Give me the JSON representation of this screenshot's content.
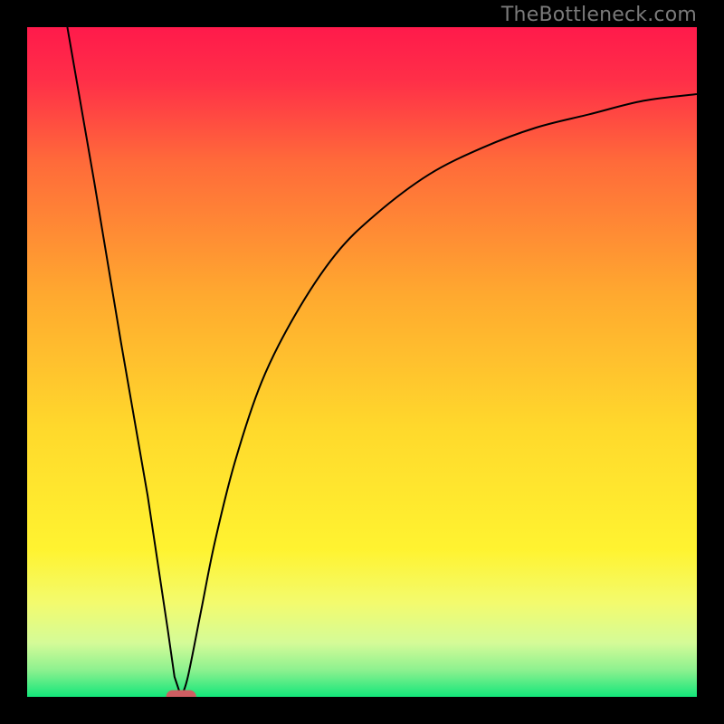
{
  "attribution": "TheBottleneck.com",
  "chart_data": {
    "type": "line",
    "title": "",
    "xlabel": "",
    "ylabel": "",
    "xlim": [
      0,
      100
    ],
    "ylim": [
      0,
      100
    ],
    "background_gradient": [
      {
        "stop": 0.0,
        "color": "#ff1a4b"
      },
      {
        "stop": 0.08,
        "color": "#ff2f48"
      },
      {
        "stop": 0.2,
        "color": "#ff6a3a"
      },
      {
        "stop": 0.4,
        "color": "#ffa92f"
      },
      {
        "stop": 0.6,
        "color": "#ffd92c"
      },
      {
        "stop": 0.78,
        "color": "#fff330"
      },
      {
        "stop": 0.86,
        "color": "#f3fb6e"
      },
      {
        "stop": 0.92,
        "color": "#d4fb98"
      },
      {
        "stop": 0.96,
        "color": "#8df18f"
      },
      {
        "stop": 1.0,
        "color": "#13e67a"
      }
    ],
    "curve": {
      "color": "#000000",
      "vertex_x": 23,
      "left_start": {
        "x": 6,
        "y": 100
      },
      "right_end": {
        "x": 100,
        "y": 90
      },
      "points": [
        {
          "x": 6,
          "y": 100
        },
        {
          "x": 10,
          "y": 77
        },
        {
          "x": 14,
          "y": 53
        },
        {
          "x": 18,
          "y": 30
        },
        {
          "x": 21,
          "y": 10
        },
        {
          "x": 22,
          "y": 3
        },
        {
          "x": 23,
          "y": 0
        },
        {
          "x": 24,
          "y": 3
        },
        {
          "x": 26,
          "y": 13
        },
        {
          "x": 28,
          "y": 23
        },
        {
          "x": 31,
          "y": 35
        },
        {
          "x": 35,
          "y": 47
        },
        {
          "x": 40,
          "y": 57
        },
        {
          "x": 46,
          "y": 66
        },
        {
          "x": 52,
          "y": 72
        },
        {
          "x": 60,
          "y": 78
        },
        {
          "x": 68,
          "y": 82
        },
        {
          "x": 76,
          "y": 85
        },
        {
          "x": 84,
          "y": 87
        },
        {
          "x": 92,
          "y": 89
        },
        {
          "x": 100,
          "y": 90
        }
      ]
    },
    "marker": {
      "shape": "pill",
      "x": 23,
      "y": 0,
      "width": 4.5,
      "height": 2.0,
      "color": "#cf5d62"
    }
  }
}
